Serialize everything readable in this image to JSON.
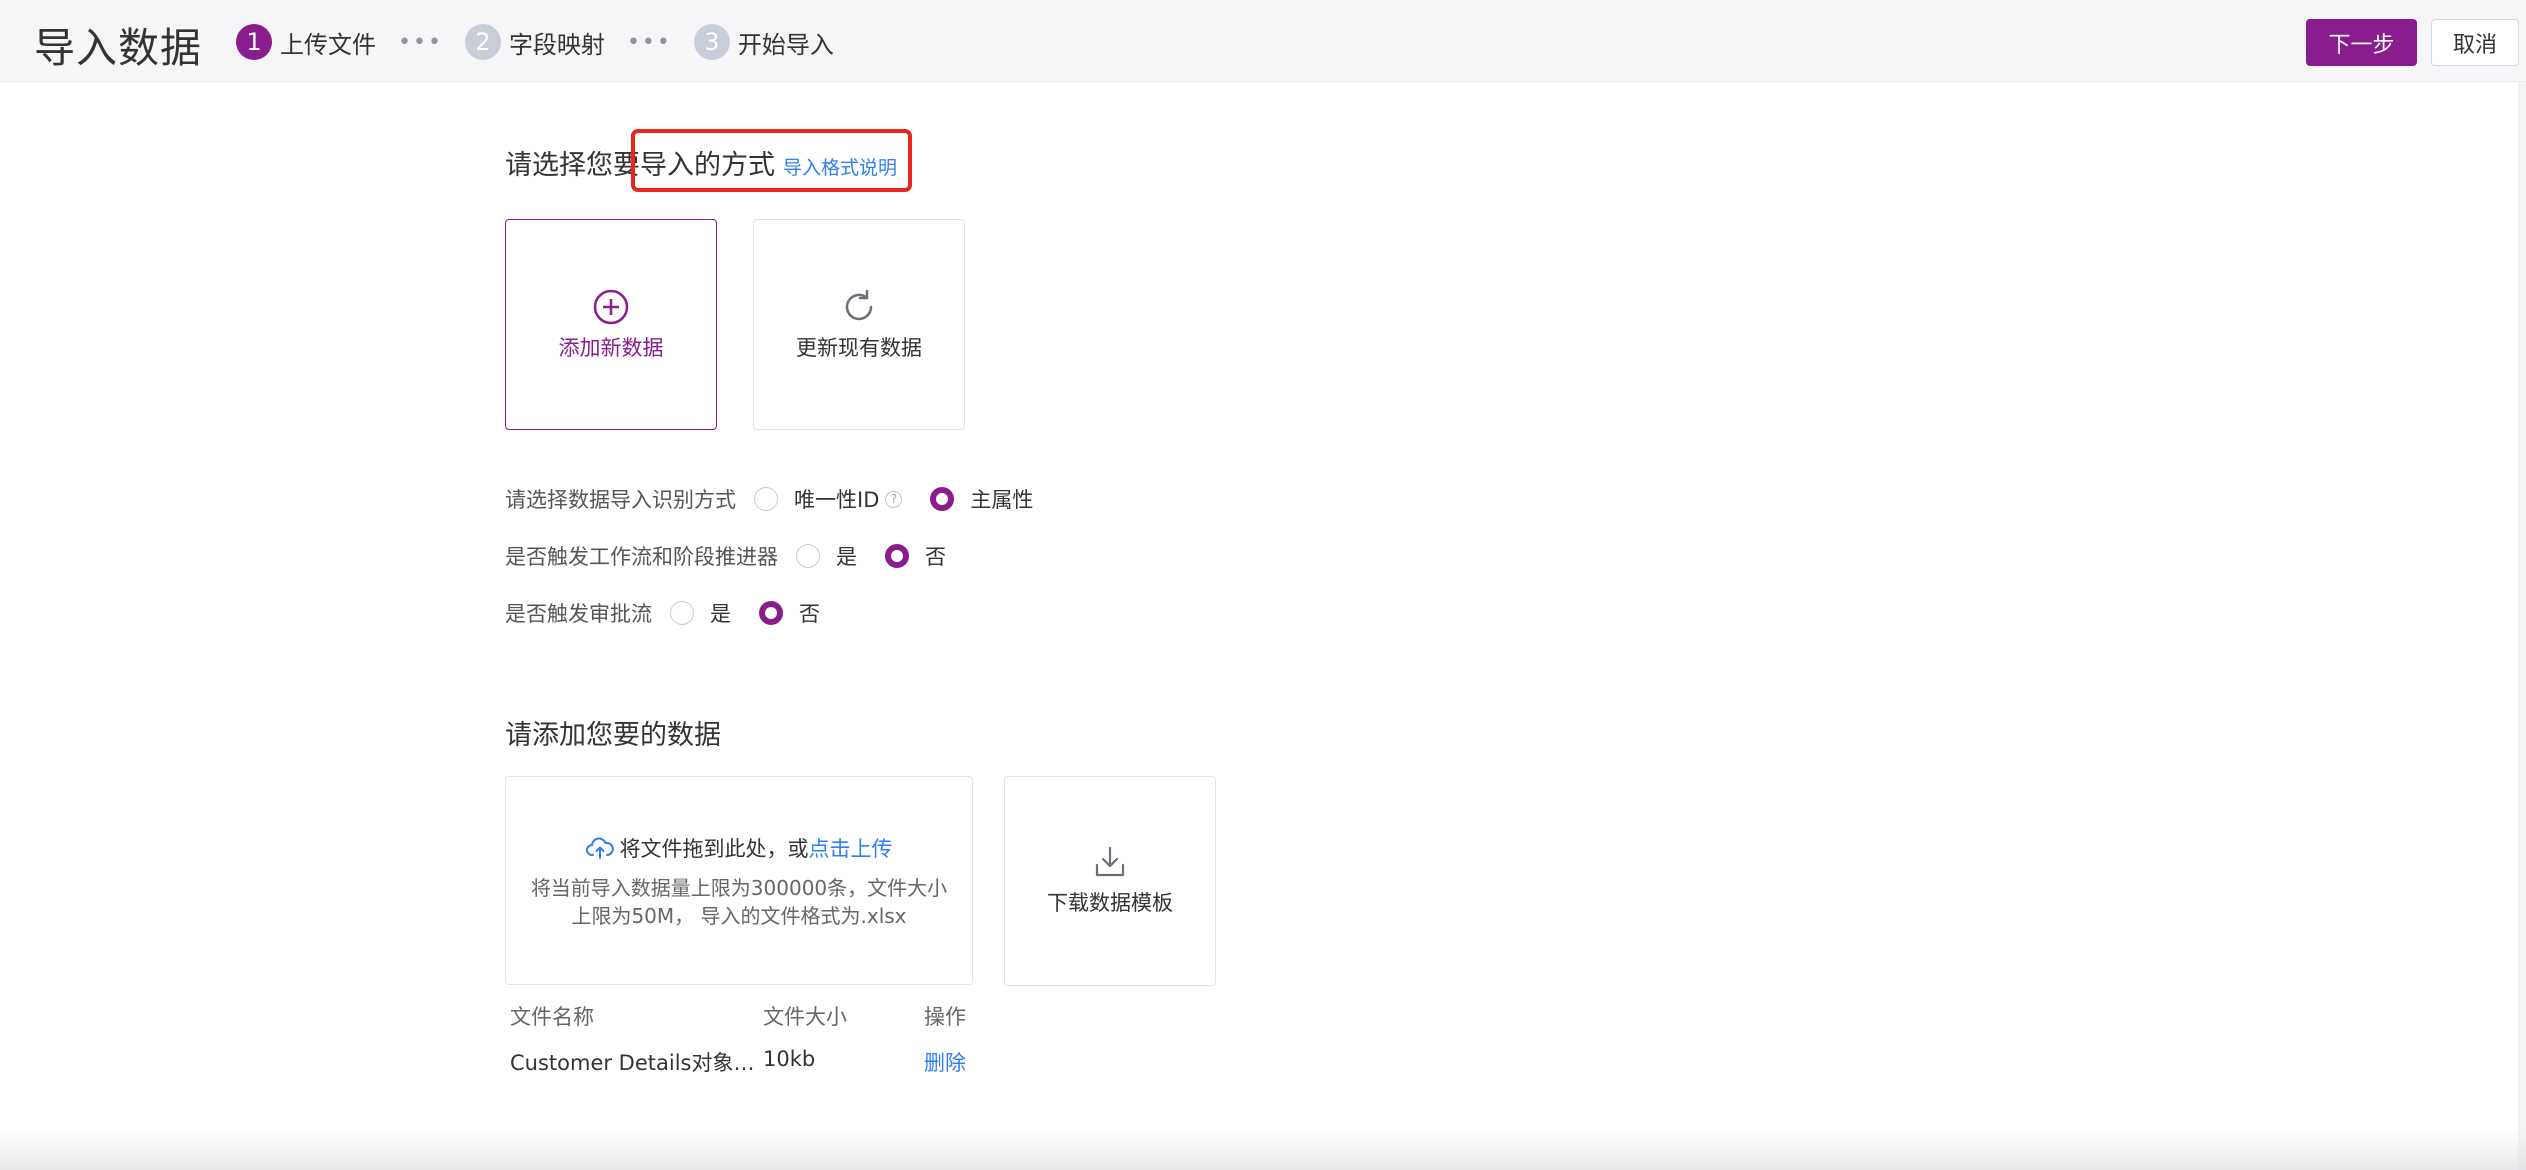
{
  "header": {
    "title": "导入数据",
    "steps": [
      {
        "num": "1",
        "label": "上传文件",
        "active": true
      },
      {
        "num": "2",
        "label": "字段映射",
        "active": false
      },
      {
        "num": "3",
        "label": "开始导入",
        "active": false
      }
    ],
    "step_separator": "•••",
    "next_label": "下一步",
    "cancel_label": "取消"
  },
  "import_mode": {
    "title": "请选择您要导入的方式",
    "help_link": "导入格式说明",
    "cards": [
      {
        "label": "添加新数据",
        "icon": "plus-circle-icon",
        "selected": true
      },
      {
        "label": "更新现有数据",
        "icon": "refresh-icon",
        "selected": false
      }
    ]
  },
  "options": [
    {
      "label": "请选择数据导入识别方式",
      "choices": [
        {
          "text": "唯一性ID",
          "checked": false,
          "has_help": true,
          "help_glyph": "?"
        },
        {
          "text": "主属性",
          "checked": true
        }
      ]
    },
    {
      "label": "是否触发工作流和阶段推进器",
      "choices": [
        {
          "text": "是",
          "checked": false
        },
        {
          "text": "否",
          "checked": true
        }
      ]
    },
    {
      "label": "是否触发审批流",
      "choices": [
        {
          "text": "是",
          "checked": false
        },
        {
          "text": "否",
          "checked": true
        }
      ]
    }
  ],
  "data_section": {
    "title": "请添加您要的数据",
    "upload": {
      "text_prefix": "将文件拖到此处，或",
      "link": "点击上传",
      "hint_line1": "将当前导入数据量上限为300000条，文件大小",
      "hint_line2": "上限为50M， 导入的文件格式为.xlsx"
    },
    "template_label": "下载数据模板"
  },
  "file_table": {
    "headers": [
      "文件名称",
      "文件大小",
      "操作"
    ],
    "rows": [
      {
        "name": "Customer Details对象…",
        "size": "10kb",
        "action": "删除"
      }
    ]
  },
  "colors": {
    "accent": "#8a1d8e",
    "link": "#2f80ed",
    "highlight": "#e8261c"
  }
}
